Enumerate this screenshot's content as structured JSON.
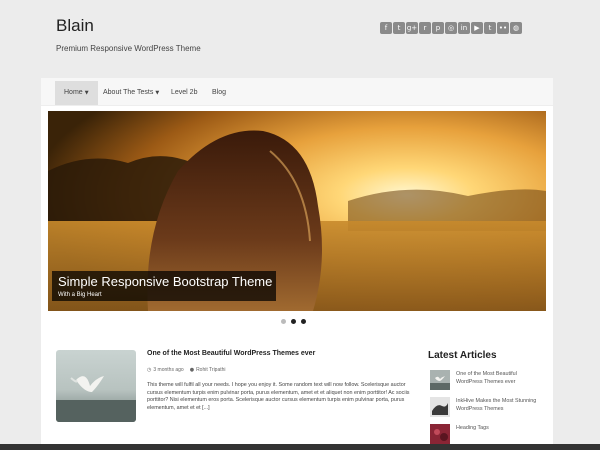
{
  "site": {
    "title": "Blain",
    "tagline": "Premium Responsive WordPress Theme"
  },
  "social_icons": [
    {
      "name": "facebook-icon",
      "glyph": "f"
    },
    {
      "name": "twitter-icon",
      "glyph": "t"
    },
    {
      "name": "google-plus-icon",
      "glyph": "g+"
    },
    {
      "name": "rss-icon",
      "glyph": "r"
    },
    {
      "name": "pinterest-icon",
      "glyph": "p"
    },
    {
      "name": "instagram-icon",
      "glyph": "◎"
    },
    {
      "name": "linkedin-icon",
      "glyph": "in"
    },
    {
      "name": "youtube-icon",
      "glyph": "▶"
    },
    {
      "name": "tumblr-icon",
      "glyph": "t"
    },
    {
      "name": "flickr-icon",
      "glyph": "••"
    },
    {
      "name": "dribbble-icon",
      "glyph": "◍"
    }
  ],
  "nav": {
    "items": [
      {
        "label": "Home",
        "dropdown": true,
        "active": true
      },
      {
        "label": "About The Tests",
        "dropdown": true,
        "active": false
      },
      {
        "label": "Level 2b",
        "dropdown": false,
        "active": false
      },
      {
        "label": "Blog",
        "dropdown": false,
        "active": false
      }
    ]
  },
  "slider": {
    "caption_title": "Simple Responsive Bootstrap Theme",
    "caption_subtitle": "With a Big Heart",
    "slide_count": 3,
    "current_slide": 1
  },
  "post": {
    "title": "One of the Most Beautiful WordPress Themes ever",
    "date": "3 months ago",
    "author": "Rohit Tripathi",
    "excerpt": "This theme will fulfil all your needs. I hope you enjoy it. Some random text will now follow. Scelerisque auctor cursus elementum turpis enim pulvinar porta, purus elementum, amet et et aliquet non enim porttitor! Ac sociis porttitor? Nisi elementum eros porta. Scelerisque auctor cursus elementum turpis enim pulvinar porta, purus elementum, amet et et [...]"
  },
  "sidebar": {
    "title": "Latest Articles",
    "items": [
      {
        "title": "One of the Most Beautiful WordPress Themes ever"
      },
      {
        "title": "InkHive Makes the Most Stunning WordPress Themes"
      },
      {
        "title": "Heading Tags"
      }
    ]
  },
  "colors": {
    "background": "#ececec",
    "icon_gray": "#8a8a8a",
    "caption_bg": "#000000",
    "active_nav": "#dedede"
  }
}
